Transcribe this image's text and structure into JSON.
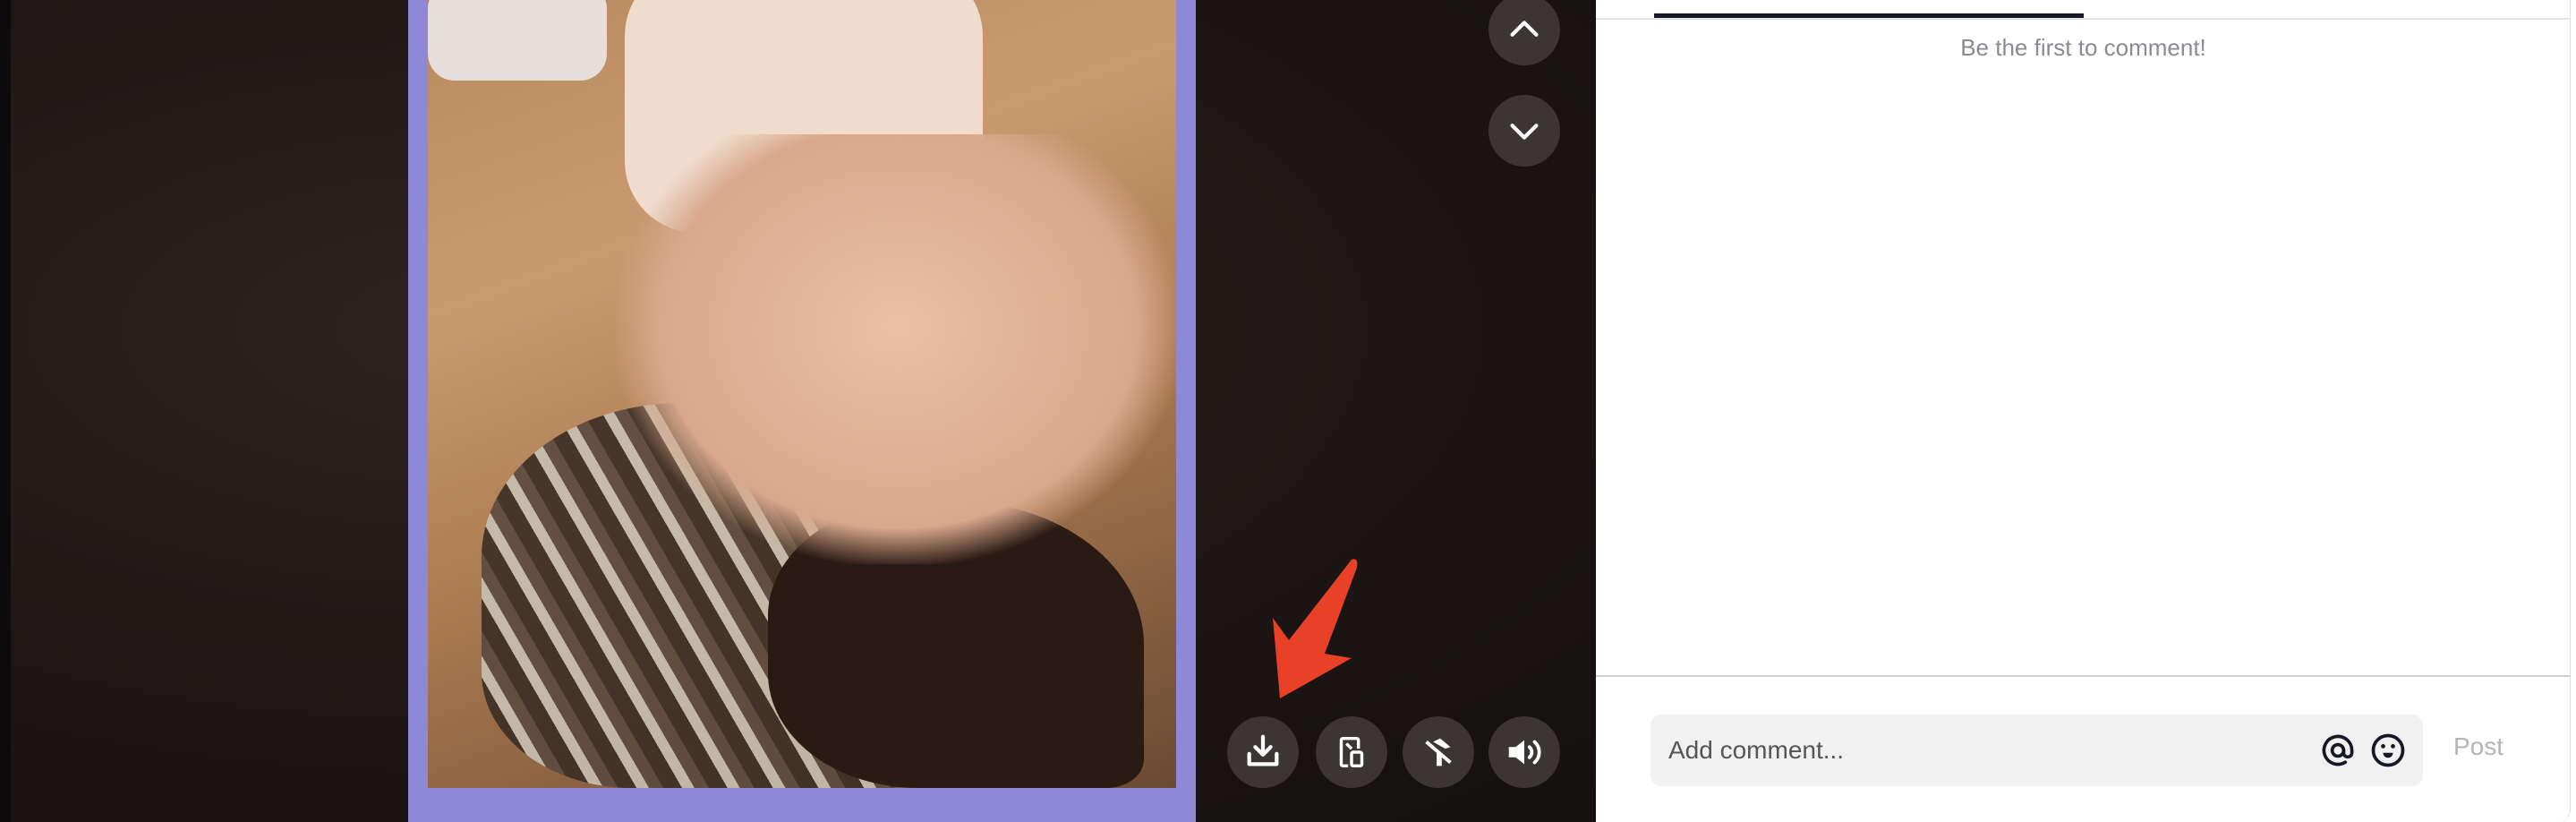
{
  "player": {
    "controls": [
      {
        "name": "download",
        "icon": "download-icon"
      },
      {
        "name": "picture-in-picture",
        "icon": "pip-icon"
      },
      {
        "name": "auto-scroll-off",
        "icon": "auto-scroll-off-icon"
      },
      {
        "name": "volume",
        "icon": "volume-icon"
      }
    ],
    "nav": [
      {
        "icon": "chevron-up-icon"
      },
      {
        "icon": "chevron-down-icon"
      }
    ],
    "annotation_color": "#e94128",
    "frame_color": "#8f88d6"
  },
  "comments": {
    "empty_text": "Be the first to comment!",
    "input_placeholder": "Add comment...",
    "post_label": "Post"
  }
}
